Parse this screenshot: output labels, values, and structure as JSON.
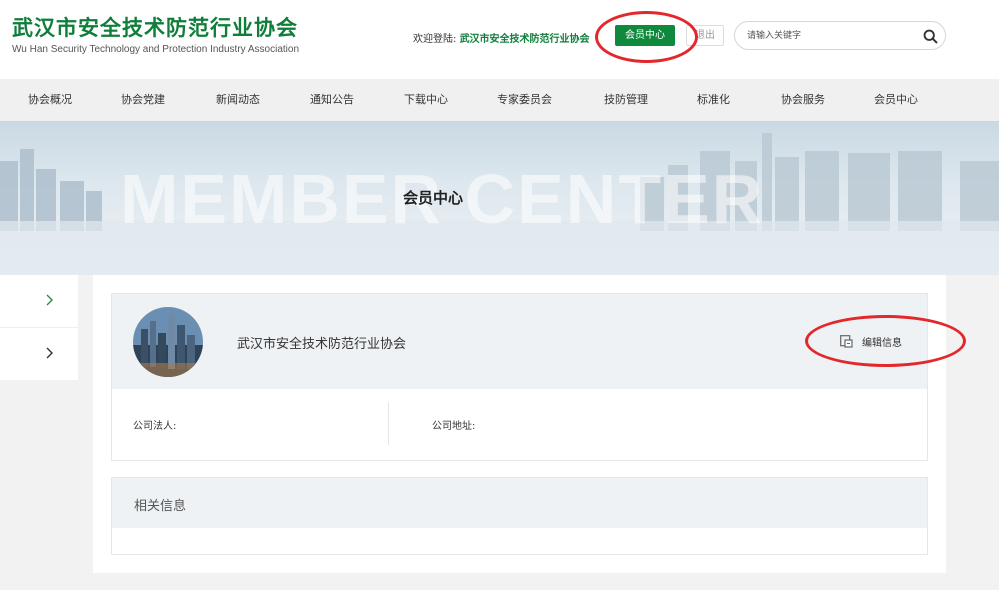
{
  "header": {
    "logo_cn": "武汉市安全技术防范行业协会",
    "logo_en": "Wu Han Security Technology and Protection Industry Association",
    "welcome_prefix": "欢迎登陆: ",
    "welcome_org": "武汉市安全技术防范行业协会",
    "member_center_button": "会员中心",
    "logout_button": "退出",
    "search": {
      "placeholder": "请输入关键字",
      "value": ""
    },
    "accent_color": "#0f8a3c"
  },
  "nav": {
    "items": [
      {
        "label": "协会概况"
      },
      {
        "label": "协会党建"
      },
      {
        "label": "新闻动态"
      },
      {
        "label": "通知公告"
      },
      {
        "label": "下载中心"
      },
      {
        "label": "专家委员会"
      },
      {
        "label": "技防管理"
      },
      {
        "label": "标准化"
      },
      {
        "label": "协会服务"
      },
      {
        "label": "会员中心"
      }
    ]
  },
  "banner": {
    "watermark": "MEMBER CENTER",
    "title": "会员中心"
  },
  "profile": {
    "name": "武汉市安全技术防范行业协会",
    "edit_label": "编辑信息",
    "legal_person_label": "公司法人:",
    "legal_person_value": "",
    "address_label": "公司地址:",
    "address_value": ""
  },
  "related": {
    "title": "相关信息"
  },
  "annotation_color": "#e2282c"
}
